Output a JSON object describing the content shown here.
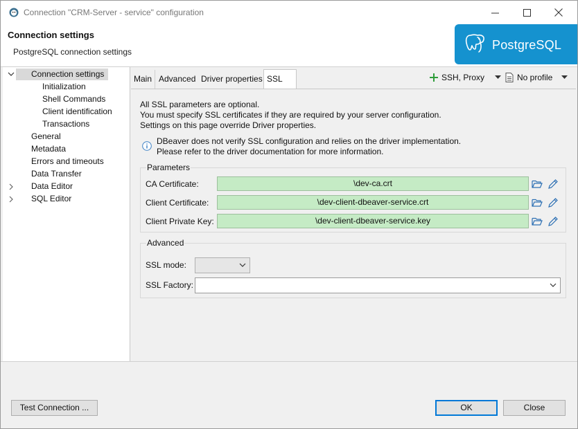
{
  "window": {
    "title": "Connection \"CRM-Server - service\" configuration"
  },
  "header": {
    "title": "Connection settings",
    "subtitle": "PostgreSQL connection settings",
    "logo_text": "PostgreSQL",
    "logo_color": "#1592cf"
  },
  "nav": {
    "items": [
      {
        "label": "Connection settings",
        "level": 0,
        "expanded": true,
        "selected": true
      },
      {
        "label": "Initialization",
        "level": 1
      },
      {
        "label": "Shell Commands",
        "level": 1
      },
      {
        "label": "Client identification",
        "level": 1
      },
      {
        "label": "Transactions",
        "level": 1
      },
      {
        "label": "General",
        "level": 0
      },
      {
        "label": "Metadata",
        "level": 0
      },
      {
        "label": "Errors and timeouts",
        "level": 0
      },
      {
        "label": "Data Transfer",
        "level": 0
      },
      {
        "label": "Data Editor",
        "level": 0,
        "expandable": true
      },
      {
        "label": "SQL Editor",
        "level": 0,
        "expandable": true
      }
    ]
  },
  "tabs": [
    {
      "label": "Main"
    },
    {
      "label": "Advanced"
    },
    {
      "label": "Driver properties"
    },
    {
      "label": "SSL",
      "active": true,
      "closable": true
    }
  ],
  "tab_actions": {
    "ssh_proxy": "SSH, Proxy",
    "profile": "No profile"
  },
  "ssl": {
    "intro": [
      "All SSL parameters are optional.",
      "You must specify SSL certificates if they are required by your server configuration.",
      "Settings on this page override Driver properties."
    ],
    "note": [
      "DBeaver does not verify SSL configuration and relies on the driver implementation.",
      "Please refer to the driver documentation for more information."
    ],
    "parameters": {
      "group_label": "Parameters",
      "ca_label": "CA Certificate:",
      "ca_value": "\\dev-ca.crt",
      "client_cert_label": "Client Certificate:",
      "client_cert_value": "\\dev-client-dbeaver-service.crt",
      "client_key_label": "Client Private Key:",
      "client_key_value": "\\dev-client-dbeaver-service.key"
    },
    "advanced": {
      "group_label": "Advanced",
      "mode_label": "SSL mode:",
      "mode_value": "",
      "factory_label": "SSL Factory:",
      "factory_value": ""
    }
  },
  "buttons": {
    "test": "Test Connection ...",
    "ok": "OK",
    "close": "Close"
  }
}
